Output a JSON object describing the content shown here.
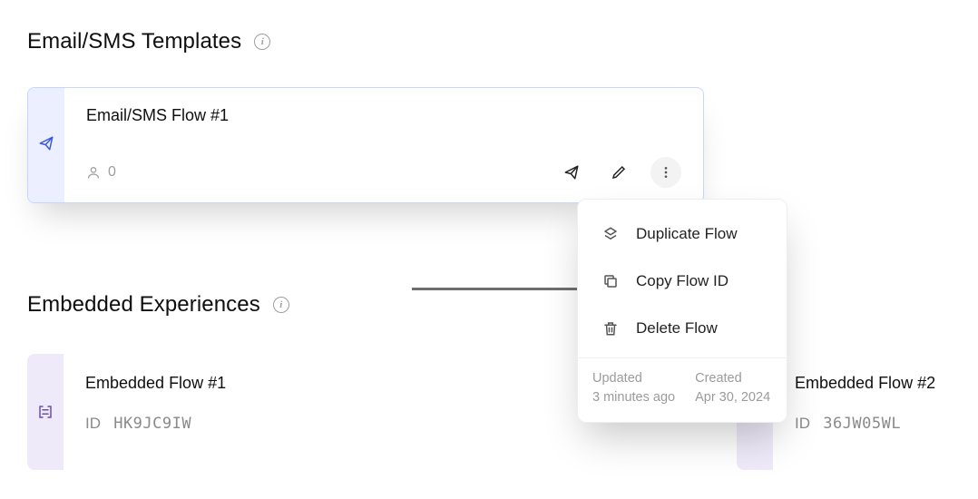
{
  "sections": {
    "email_sms": {
      "title": "Email/SMS Templates",
      "card": {
        "title": "Email/SMS Flow #1",
        "audience_count": "0"
      }
    },
    "embedded": {
      "title": "Embedded Experiences",
      "cards": [
        {
          "title": "Embedded Flow #1",
          "id_label": "ID",
          "id_value": "HK9JC9IW"
        },
        {
          "title": "Embedded Flow #2",
          "id_label": "ID",
          "id_value": "36JW05WL"
        }
      ]
    }
  },
  "popover": {
    "items": {
      "duplicate": "Duplicate Flow",
      "copy_id": "Copy Flow ID",
      "delete": "Delete Flow"
    },
    "meta": {
      "updated_label": "Updated",
      "updated_value": "3 minutes ago",
      "created_label": "Created",
      "created_value": "Apr 30, 2024"
    }
  },
  "colors": {
    "accent_blue": "#3b57e0",
    "purple": "#6b4fb3"
  }
}
